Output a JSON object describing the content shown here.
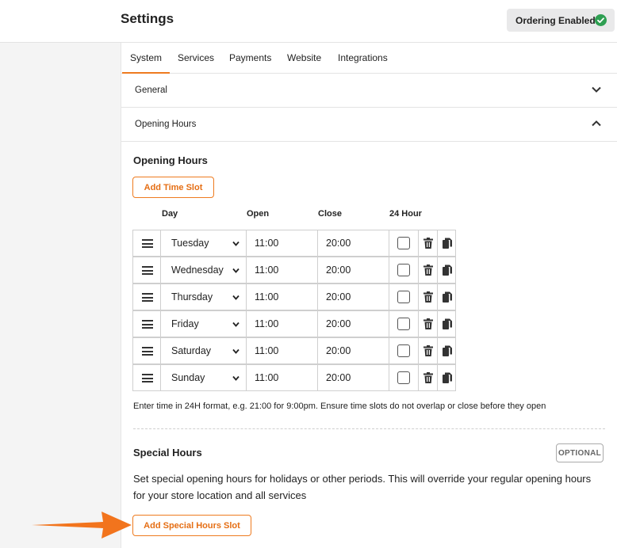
{
  "header": {
    "title": "Settings",
    "status_label": "Ordering Enabled",
    "status_color": "#2e9f52"
  },
  "tabs": [
    {
      "label": "System",
      "active": true
    },
    {
      "label": "Services",
      "active": false
    },
    {
      "label": "Payments",
      "active": false
    },
    {
      "label": "Website",
      "active": false
    },
    {
      "label": "Integrations",
      "active": false
    }
  ],
  "accordions": {
    "general": {
      "label": "General",
      "expanded": false
    },
    "opening_hours": {
      "label": "Opening Hours",
      "expanded": true
    }
  },
  "opening_hours": {
    "title": "Opening Hours",
    "add_button": "Add Time Slot",
    "columns": {
      "day": "Day",
      "open": "Open",
      "close": "Close",
      "allday": "24 Hour"
    },
    "rows": [
      {
        "day": "Tuesday",
        "open": "11:00",
        "close": "20:00",
        "allday": false
      },
      {
        "day": "Wednesday",
        "open": "11:00",
        "close": "20:00",
        "allday": false
      },
      {
        "day": "Thursday",
        "open": "11:00",
        "close": "20:00",
        "allday": false
      },
      {
        "day": "Friday",
        "open": "11:00",
        "close": "20:00",
        "allday": false
      },
      {
        "day": "Saturday",
        "open": "11:00",
        "close": "20:00",
        "allday": false
      },
      {
        "day": "Sunday",
        "open": "11:00",
        "close": "20:00",
        "allday": false
      }
    ],
    "hint": "Enter time in 24H format, e.g. 21:00 for 9:00pm. Ensure time slots do not overlap or close before they open"
  },
  "special_hours": {
    "title": "Special Hours",
    "badge": "OPTIONAL",
    "description": "Set special opening hours for holidays or other periods. This will override your regular opening hours for your store location and all services",
    "add_button": "Add Special Hours Slot"
  },
  "accent_color": "#ee7b1f"
}
